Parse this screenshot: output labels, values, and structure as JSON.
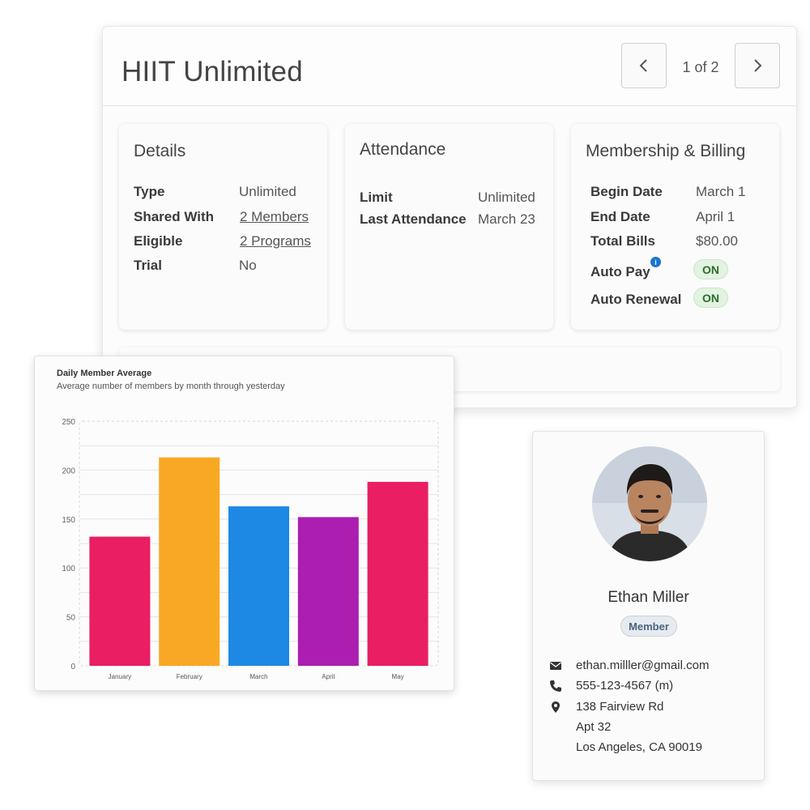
{
  "membership": {
    "title": "HIIT Unlimited",
    "pager": {
      "text": "1 of 2"
    },
    "details": {
      "title": "Details",
      "rows": [
        {
          "key": "Type",
          "value": "Unlimited"
        },
        {
          "key": "Shared With",
          "value": "2 Members"
        },
        {
          "key": "Eligible",
          "value": "2 Programs"
        },
        {
          "key": "Trial",
          "value": "No"
        }
      ]
    },
    "attendance": {
      "title": "Attendance",
      "rows": [
        {
          "key": "Limit",
          "value": "Unlimited"
        },
        {
          "key": "Last Attendance",
          "value": "March 23"
        }
      ]
    },
    "billing": {
      "title": "Membership & Billing",
      "rows": [
        {
          "key": "Begin Date",
          "value": "March 1"
        },
        {
          "key": "End Date",
          "value": "April 1"
        },
        {
          "key": "Total Bills",
          "value": "$80.00"
        },
        {
          "key": "Auto Pay",
          "value": "ON"
        },
        {
          "key": "Auto Renewal",
          "value": "ON"
        }
      ],
      "info_icon": "i"
    }
  },
  "chart_data": {
    "type": "bar",
    "title": "Daily Member Average",
    "subtitle": "Average number of members by month through yesterday",
    "categories": [
      "January",
      "February",
      "March",
      "April",
      "May"
    ],
    "values": [
      132,
      213,
      163,
      152,
      188
    ],
    "colors": [
      "#e91e63",
      "#f9a825",
      "#1e88e5",
      "#ab1eb0",
      "#e91e63"
    ],
    "ylim": [
      0,
      250
    ],
    "yticks": [
      0,
      50,
      100,
      150,
      200,
      250
    ],
    "grid": true
  },
  "profile": {
    "name": "Ethan Miller",
    "role": "Member",
    "email": "ethan.milller@gmail.com",
    "phone": "555-123-4567 (m)",
    "address_line1": "138 Fairview Rd",
    "address_line2": "Apt 32",
    "address_line3": "Los Angeles, CA 90019",
    "icons": [
      "envelope-icon",
      "phone-icon",
      "map-pin-icon"
    ]
  }
}
